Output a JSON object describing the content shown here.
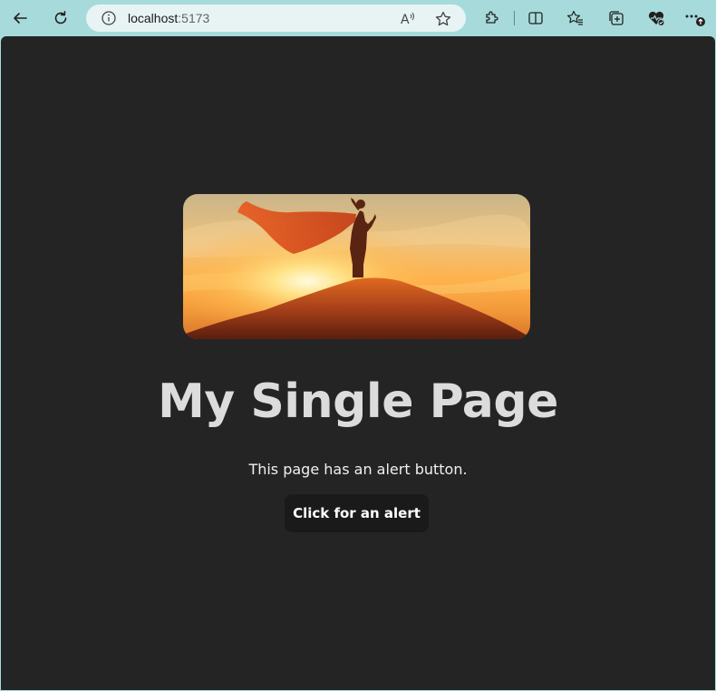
{
  "browser": {
    "url_host": "localhost",
    "url_port": ":5173",
    "accent": "#a7dbdb",
    "icons": [
      "back-arrow-icon",
      "refresh-icon",
      "info-icon",
      "read-aloud-icon",
      "favorite-star-icon",
      "extensions-icon",
      "split-screen-icon",
      "favorites-list-icon",
      "collections-icon",
      "browser-essentials-icon",
      "more-options-icon"
    ],
    "read_aloud_glyph": "A"
  },
  "page": {
    "background": "#242424",
    "hero_image": "sunset-superhero-cape-image",
    "title": "My Single Page",
    "description": "This page has an alert button.",
    "button_label": "Click for an alert"
  }
}
